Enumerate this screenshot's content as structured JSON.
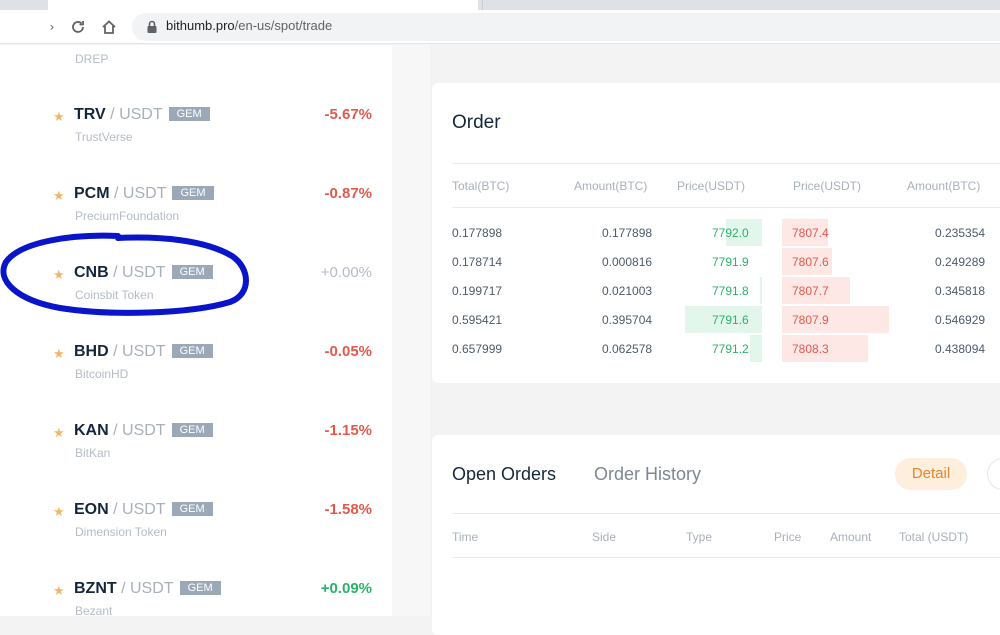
{
  "browser": {
    "url_host": "bithumb.pro",
    "url_path": "/en-us/spot/trade"
  },
  "markets": {
    "top_partial_name": "DREP",
    "rows": [
      {
        "symbol": "TRV",
        "quote": "/ USDT",
        "tag": "GEM",
        "name": "TrustVerse",
        "change": "-5.67%"
      },
      {
        "symbol": "PCM",
        "quote": "/ USDT",
        "tag": "GEM",
        "name": "PreciumFoundation",
        "change": "-0.87%"
      },
      {
        "symbol": "CNB",
        "quote": "/ USDT",
        "tag": "GEM",
        "name": "Coinsbit Token",
        "change": "+0.00%"
      },
      {
        "symbol": "BHD",
        "quote": "/ USDT",
        "tag": "GEM",
        "name": "BitcoinHD",
        "change": "-0.05%"
      },
      {
        "symbol": "KAN",
        "quote": "/ USDT",
        "tag": "GEM",
        "name": "BitKan",
        "change": "-1.15%"
      },
      {
        "symbol": "EON",
        "quote": "/ USDT",
        "tag": "GEM",
        "name": "Dimension Token",
        "change": "-1.58%"
      },
      {
        "symbol": "BZNT",
        "quote": "/ USDT",
        "tag": "GEM",
        "name": "Bezant",
        "change": "+0.09%"
      }
    ]
  },
  "order": {
    "title": "Order",
    "headers": [
      "Total(BTC)",
      "Amount(BTC)",
      "Price(USDT)",
      "Price(USDT)",
      "Amount(BTC)"
    ],
    "rows": [
      [
        "0.177898",
        "0.177898",
        "7792.0",
        "7807.4",
        "0.235354"
      ],
      [
        "0.178714",
        "0.000816",
        "7791.9",
        "7807.6",
        "0.249289"
      ],
      [
        "0.199717",
        "0.021003",
        "7791.8",
        "7807.7",
        "0.345818"
      ],
      [
        "0.595421",
        "0.395704",
        "7791.6",
        "7807.9",
        "0.546929"
      ],
      [
        "0.657999",
        "0.062578",
        "7791.2",
        "7808.3",
        "0.438094"
      ]
    ]
  },
  "open_orders": {
    "tab_open": "Open Orders",
    "tab_history": "Order History",
    "detail_label": "Detail",
    "headers": [
      "Time",
      "Side",
      "Type",
      "Price",
      "Amount",
      "Total (USDT)"
    ]
  },
  "colors": {
    "negative": "#e25a4d",
    "positive": "#2bb26a",
    "accent_orange": "#e8852a",
    "annotation_blue": "#0a14c8"
  }
}
